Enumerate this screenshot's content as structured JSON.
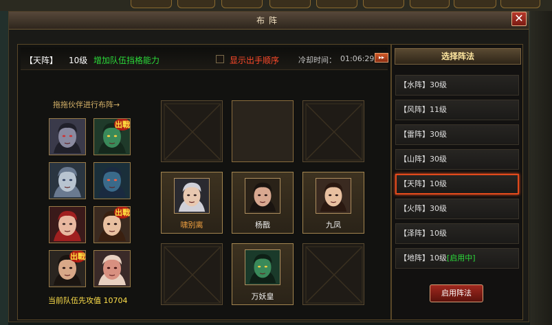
{
  "window": {
    "title": "布阵",
    "close_label": "✕"
  },
  "info_bar": {
    "formation_name": "【天阵】",
    "formation_level": "10级",
    "formation_desc": "增加队伍挡格能力",
    "show_order_label": "显示出手顺序",
    "cooldown_label": "冷却时间：",
    "cooldown_time": "01:06:29",
    "fast_forward": "▸▸"
  },
  "partners": {
    "hint": "拖拖伙伴进行布阵→",
    "team_power": "当前队伍先攻值 10704",
    "chuzhan_text": "出戰",
    "list": [
      {
        "icon": "pale-demon-portrait",
        "in_battle": false
      },
      {
        "icon": "green-demon-portrait",
        "in_battle": true
      },
      {
        "icon": "blue-haired-girl-portrait",
        "in_battle": false
      },
      {
        "icon": "blue-ogre-portrait",
        "in_battle": false
      },
      {
        "icon": "red-haired-girl-portrait",
        "in_battle": false
      },
      {
        "icon": "young-warrior-portrait",
        "in_battle": true
      },
      {
        "icon": "bearded-warrior-portrait",
        "in_battle": true
      },
      {
        "icon": "pink-demon-portrait",
        "in_battle": false
      }
    ]
  },
  "grid": {
    "cells": [
      {
        "state": "empty"
      },
      {
        "state": "plain"
      },
      {
        "state": "empty"
      },
      {
        "state": "filled",
        "name": "啸别离",
        "icon": "silver-hair-hero-portrait",
        "color": "#f0a040"
      },
      {
        "state": "filled",
        "name": "杨戬",
        "icon": "yang-jian-portrait",
        "color": "#f0f0f0"
      },
      {
        "state": "filled",
        "name": "九凤",
        "icon": "jiu-feng-portrait",
        "color": "#f0f0f0"
      },
      {
        "state": "empty"
      },
      {
        "state": "filled",
        "name": "万妖皇",
        "icon": "demon-emperor-portrait",
        "color": "#f0f0f0"
      },
      {
        "state": "empty"
      }
    ]
  },
  "formations_panel": {
    "header": "选择阵法",
    "items": [
      {
        "name": "【水阵】30级",
        "active": false,
        "inuse": ""
      },
      {
        "name": "【风阵】11级",
        "active": false,
        "inuse": ""
      },
      {
        "name": "【雷阵】30级",
        "active": false,
        "inuse": ""
      },
      {
        "name": "【山阵】30级",
        "active": false,
        "inuse": ""
      },
      {
        "name": "【天阵】10级",
        "active": true,
        "inuse": ""
      },
      {
        "name": "【火阵】30级",
        "active": false,
        "inuse": ""
      },
      {
        "name": "【泽阵】10级",
        "active": false,
        "inuse": ""
      },
      {
        "name": "【地阵】10级",
        "active": false,
        "inuse": "[启用中]"
      }
    ],
    "use_button": "启用阵法"
  },
  "colors": {
    "accent_green": "#2bdc3a",
    "accent_red": "#e24a1c",
    "gold": "#ffe04a"
  }
}
